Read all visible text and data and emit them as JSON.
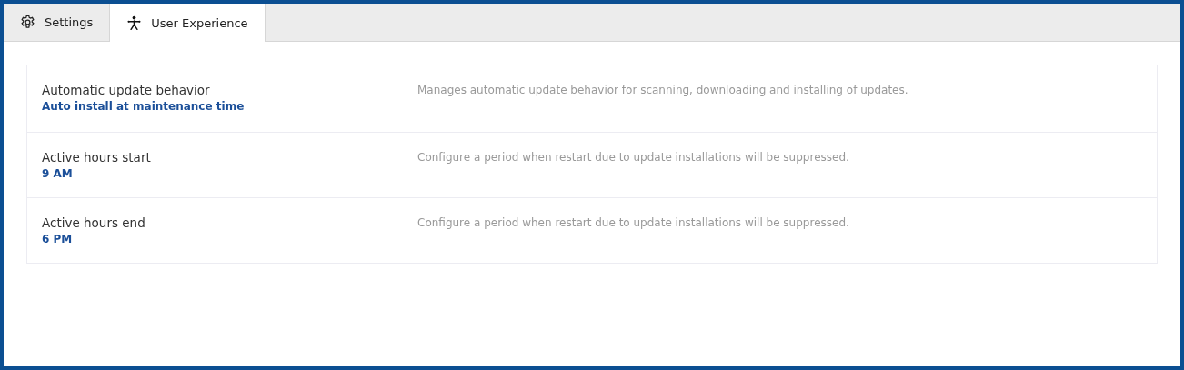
{
  "tabs": [
    {
      "label": "Settings",
      "selected": false
    },
    {
      "label": "User Experience",
      "selected": true
    }
  ],
  "settings": [
    {
      "name": "Automatic update behavior",
      "value": "Auto install at maintenance time",
      "description": "Manages automatic update behavior for scanning, downloading and installing of updates."
    },
    {
      "name": "Active hours start",
      "value": "9 AM",
      "description": "Configure a period when restart due to update installations will be suppressed."
    },
    {
      "name": "Active hours end",
      "value": "6 PM",
      "description": "Configure a period when restart due to update installations will be suppressed."
    }
  ]
}
